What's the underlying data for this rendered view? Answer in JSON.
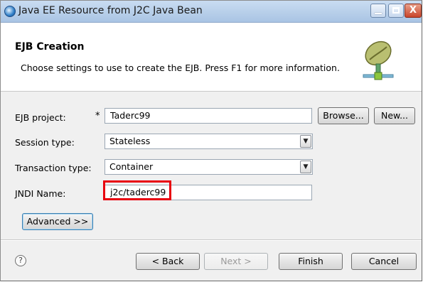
{
  "window": {
    "title": "Java EE Resource from J2C Java Bean",
    "controls": {
      "minimize": "_",
      "maximize": "□",
      "close": "X"
    }
  },
  "header": {
    "title": "EJB Creation",
    "description": "Choose settings to use to create the EJB. Press F1 for more information.",
    "icon": "java-bean-icon"
  },
  "form": {
    "ejb_project": {
      "label": "EJB project:",
      "required_marker": "*",
      "value": "Taderc99",
      "browse_label": "Browse...",
      "new_label": "New..."
    },
    "session_type": {
      "label": "Session type:",
      "value": "Stateless"
    },
    "transaction_type": {
      "label": "Transaction type:",
      "value": "Container"
    },
    "jndi_name": {
      "label": "JNDI Name:",
      "value": "j2c/taderc99"
    },
    "advanced_label": "Advanced >>"
  },
  "footer": {
    "help_icon": "help-icon",
    "help_glyph": "?",
    "back_label": "< Back",
    "next_label": "Next >",
    "finish_label": "Finish",
    "cancel_label": "Cancel"
  },
  "colors": {
    "highlight": "#e8000f",
    "titlebar": "#b9d0ea",
    "close_button": "#c9452b"
  }
}
